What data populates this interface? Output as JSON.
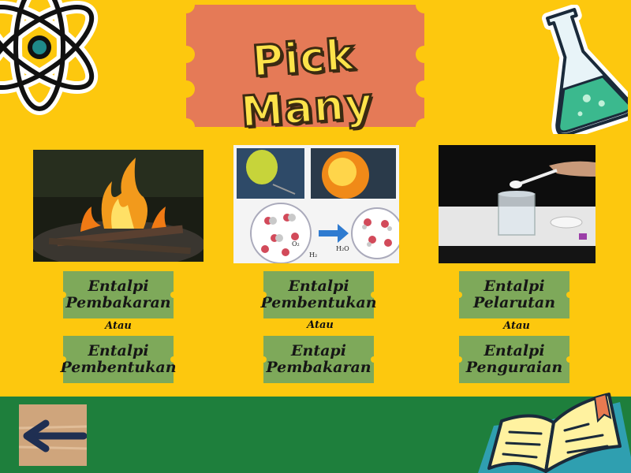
{
  "title": "Pick Many",
  "colors": {
    "background": "#fdc80e",
    "bottom_band": "#1e7f3c",
    "title_ticket": "#e57a57",
    "option_ticket": "#7ea95a"
  },
  "columns": [
    {
      "image": "burning-fire",
      "options": [
        {
          "line1": "Entalpi",
          "line2": "Pembakaran"
        },
        {
          "line1": "Entalpi",
          "line2": "Pembentukan"
        }
      ],
      "separator": "Atau"
    },
    {
      "image": "balloon-explosion-molecules",
      "image_labels": {
        "o2": "O₂",
        "h2": "H₂",
        "h2o": "H₂O"
      },
      "options": [
        {
          "line1": "Entalpi",
          "line2": "Pembentukan"
        },
        {
          "line1": "Entapi",
          "line2": "Pembakaran"
        }
      ],
      "separator": "Atau"
    },
    {
      "image": "dissolving-salt",
      "options": [
        {
          "line1": "Entalpi",
          "line2": "Pelarutan"
        },
        {
          "line1": "Entalpi",
          "line2": "Penguraian"
        }
      ],
      "separator": "Atau"
    }
  ],
  "icons": {
    "atom": "atom-icon",
    "flask": "flask-icon",
    "book": "book-icon",
    "back": "back-arrow-icon"
  }
}
